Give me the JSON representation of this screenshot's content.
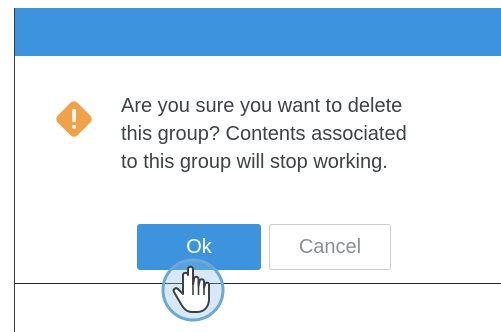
{
  "dialog": {
    "message": "Are you sure you want to delete\nthis group? Contents associated\nto this group will stop working.",
    "icon": "warning-icon",
    "accent_color": "#3d93dd",
    "warning_color": "#f0a24a"
  },
  "buttons": {
    "ok_label": "Ok",
    "cancel_label": "Cancel"
  },
  "cursor": {
    "icon": "hand-pointer-icon"
  }
}
